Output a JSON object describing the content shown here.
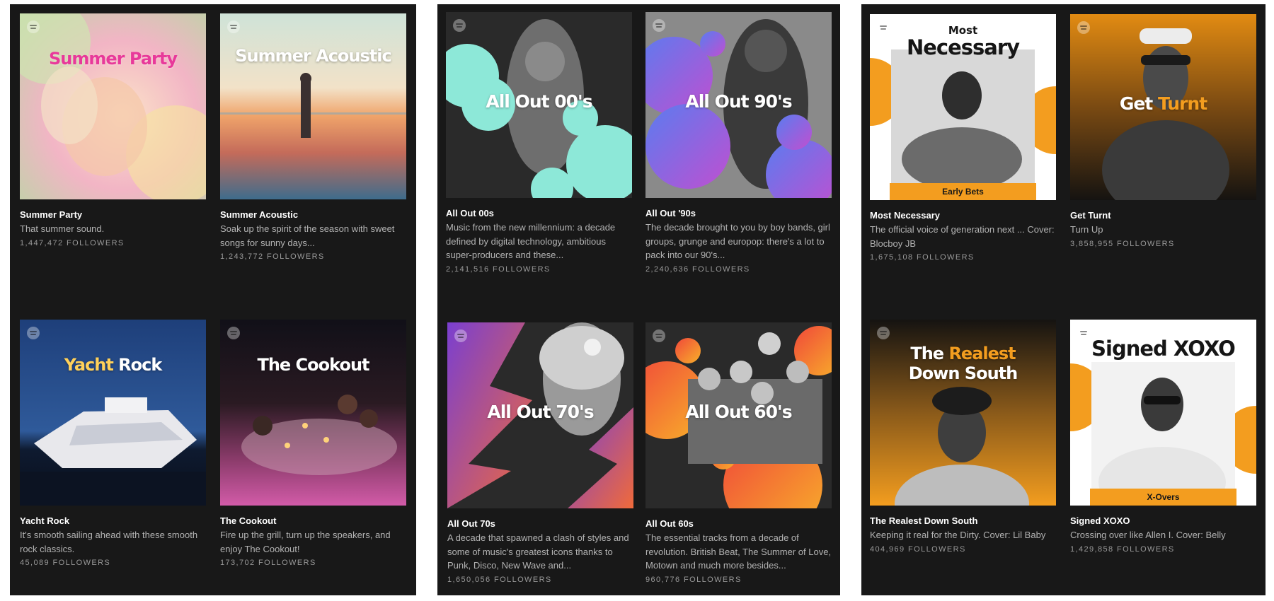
{
  "panels": [
    {
      "cards": [
        {
          "cover_text": "Summer Party",
          "title": "Summer Party",
          "description": "That summer sound.",
          "followers": "1,447,472 FOLLOWERS"
        },
        {
          "cover_text": "Summer Acoustic",
          "title": "Summer Acoustic",
          "description": "Soak up the spirit of the season with sweet songs for sunny days...",
          "followers": "1,243,772 FOLLOWERS"
        },
        {
          "cover_text_a": "Yacht",
          "cover_text_b": "Rock",
          "title": "Yacht Rock",
          "description": "It's smooth sailing ahead with these smooth rock classics.",
          "followers": "45,089 FOLLOWERS"
        },
        {
          "cover_text": "The Cookout",
          "title": "The Cookout",
          "description": "Fire up the grill, turn up the speakers, and enjoy The Cookout!",
          "followers": "173,702 FOLLOWERS"
        }
      ]
    },
    {
      "cards": [
        {
          "cover_text": "All Out 00's",
          "title": "All Out 00s",
          "description": "Music from the new millennium: a decade defined by digital technology, ambitious super-producers and these...",
          "followers": "2,141,516 FOLLOWERS"
        },
        {
          "cover_text": "All Out 90's",
          "title": "All Out '90s",
          "description": "The decade brought to you by boy bands, girl groups, grunge and europop: there's a lot to pack into our 90's...",
          "followers": "2,240,636 FOLLOWERS"
        },
        {
          "cover_text": "All Out 70's",
          "title": "All Out 70s",
          "description": "A decade that spawned a clash of styles and some of music's greatest icons thanks to Punk, Disco, New Wave and...",
          "followers": "1,650,056 FOLLOWERS"
        },
        {
          "cover_text": "All Out 60's",
          "title": "All Out 60s",
          "description": "The essential tracks from a decade of revolution. British Beat, The Summer of Love, Motown and much more besides...",
          "followers": "960,776 FOLLOWERS"
        }
      ]
    },
    {
      "cards": [
        {
          "cover_text_small": "Most",
          "cover_text": "Necessary",
          "cover_label": "Early Bets",
          "title": "Most Necessary",
          "description": "The official voice of generation next ... Cover: Blocboy JB",
          "followers": "1,675,108 FOLLOWERS"
        },
        {
          "cover_text_a": "Get",
          "cover_text_b": "Turnt",
          "title": "Get Turnt",
          "description": "Turn Up",
          "followers": "3,858,955 FOLLOWERS"
        },
        {
          "cover_text_a": "The",
          "cover_text_b": "Realest",
          "cover_text_c": "Down South",
          "title": "The Realest Down South",
          "description": "Keeping it real for the Dirty. Cover: Lil Baby",
          "followers": "404,969 FOLLOWERS"
        },
        {
          "cover_text": "Signed XOXO",
          "cover_label": "X-Overs",
          "title": "Signed XOXO",
          "description": "Crossing over like Allen I. Cover: Belly",
          "followers": "1,429,858 FOLLOWERS"
        }
      ]
    }
  ],
  "colors": {
    "panel_bg": "#181818",
    "title": "#ffffff",
    "description": "#b3b3b3",
    "followers": "#9a9a9a",
    "accent_orange": "#f39d1f",
    "accent_mint": "#8de8d8",
    "accent_pink": "#e8399a",
    "accent_yellow": "#ffd15a"
  },
  "icons": [
    "spotify-logo-icon"
  ]
}
